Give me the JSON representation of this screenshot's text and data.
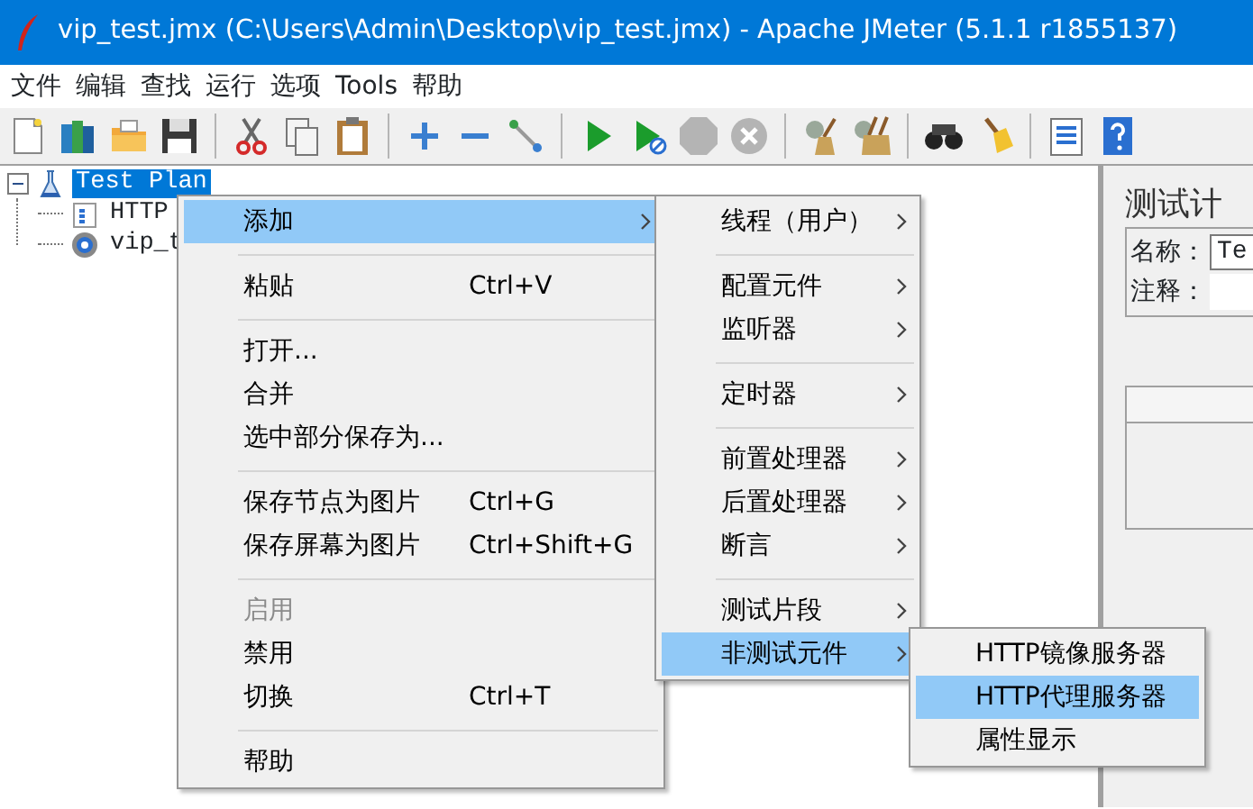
{
  "window": {
    "title": "vip_test.jmx (C:\\Users\\Admin\\Desktop\\vip_test.jmx) - Apache JMeter (5.1.1 r1855137)"
  },
  "menu_bar": [
    "文件",
    "编辑",
    "查找",
    "运行",
    "选项",
    "Tools",
    "帮助"
  ],
  "toolbar": [
    {
      "kind": "new",
      "disabled": false
    },
    {
      "kind": "templates",
      "disabled": false
    },
    {
      "kind": "open",
      "disabled": false
    },
    {
      "kind": "save",
      "disabled": false
    },
    {
      "kind": "separator"
    },
    {
      "kind": "cut",
      "disabled": false
    },
    {
      "kind": "copy",
      "disabled": false
    },
    {
      "kind": "paste",
      "disabled": false
    },
    {
      "kind": "separator"
    },
    {
      "kind": "expand",
      "disabled": false
    },
    {
      "kind": "collapse",
      "disabled": false
    },
    {
      "kind": "toggle",
      "disabled": false
    },
    {
      "kind": "separator"
    },
    {
      "kind": "start",
      "disabled": false
    },
    {
      "kind": "start-no-timers",
      "disabled": false
    },
    {
      "kind": "stop",
      "disabled": true
    },
    {
      "kind": "shutdown",
      "disabled": true
    },
    {
      "kind": "separator"
    },
    {
      "kind": "clear",
      "disabled": false
    },
    {
      "kind": "clear-all",
      "disabled": false
    },
    {
      "kind": "separator"
    },
    {
      "kind": "search",
      "disabled": false
    },
    {
      "kind": "reset-search",
      "disabled": false
    },
    {
      "kind": "separator"
    },
    {
      "kind": "function-helper",
      "disabled": false
    },
    {
      "kind": "help",
      "disabled": false
    }
  ],
  "tree": [
    {
      "label": "Test Plan",
      "kind": "test-plan",
      "selected": true,
      "expanded": true,
      "children": [
        {
          "label": "HTTP",
          "kind": "config",
          "selected": false
        },
        {
          "label": "vip_t",
          "kind": "thread-group",
          "selected": false
        }
      ]
    }
  ],
  "panel": {
    "title": "测试计",
    "fields": [
      {
        "label": "名称：",
        "value": "Te"
      },
      {
        "label": "注释："
      }
    ]
  },
  "context_menus": [
    {
      "items": [
        {
          "kind": "item",
          "label": "添加",
          "selected": true,
          "disabled": false,
          "submenu": true
        },
        {
          "kind": "separator"
        },
        {
          "kind": "item",
          "label": "粘贴",
          "shortcut": "Ctrl+V",
          "selected": false,
          "disabled": false,
          "submenu": false
        },
        {
          "kind": "separator"
        },
        {
          "kind": "item",
          "label": "打开...",
          "selected": false,
          "disabled": false,
          "submenu": false
        },
        {
          "kind": "item",
          "label": "合并",
          "selected": false,
          "disabled": false,
          "submenu": false
        },
        {
          "kind": "item",
          "label": "选中部分保存为...",
          "selected": false,
          "disabled": false,
          "submenu": false
        },
        {
          "kind": "separator"
        },
        {
          "kind": "item",
          "label": "保存节点为图片",
          "shortcut": "Ctrl+G",
          "selected": false,
          "disabled": false,
          "submenu": false
        },
        {
          "kind": "item",
          "label": "保存屏幕为图片",
          "shortcut": "Ctrl+Shift+G",
          "selected": false,
          "disabled": false,
          "submenu": false
        },
        {
          "kind": "separator"
        },
        {
          "kind": "item",
          "label": "启用",
          "selected": false,
          "disabled": true,
          "submenu": false
        },
        {
          "kind": "item",
          "label": "禁用",
          "selected": false,
          "disabled": false,
          "submenu": false
        },
        {
          "kind": "item",
          "label": "切换",
          "shortcut": "Ctrl+T",
          "selected": false,
          "disabled": false,
          "submenu": false
        },
        {
          "kind": "separator"
        },
        {
          "kind": "item",
          "label": "帮助",
          "selected": false,
          "disabled": false,
          "submenu": false
        }
      ]
    },
    {
      "items": [
        {
          "kind": "item",
          "label": "线程（用户）",
          "selected": false,
          "disabled": false,
          "submenu": true
        },
        {
          "kind": "separator"
        },
        {
          "kind": "item",
          "label": "配置元件",
          "selected": false,
          "disabled": false,
          "submenu": true
        },
        {
          "kind": "item",
          "label": "监听器",
          "selected": false,
          "disabled": false,
          "submenu": true
        },
        {
          "kind": "separator"
        },
        {
          "kind": "item",
          "label": "定时器",
          "selected": false,
          "disabled": false,
          "submenu": true
        },
        {
          "kind": "separator"
        },
        {
          "kind": "item",
          "label": "前置处理器",
          "selected": false,
          "disabled": false,
          "submenu": true
        },
        {
          "kind": "item",
          "label": "后置处理器",
          "selected": false,
          "disabled": false,
          "submenu": true
        },
        {
          "kind": "item",
          "label": "断言",
          "selected": false,
          "disabled": false,
          "submenu": true
        },
        {
          "kind": "separator"
        },
        {
          "kind": "item",
          "label": "测试片段",
          "selected": false,
          "disabled": false,
          "submenu": true
        },
        {
          "kind": "item",
          "label": "非测试元件",
          "selected": true,
          "disabled": false,
          "submenu": true
        }
      ]
    },
    {
      "items": [
        {
          "kind": "item",
          "label": "HTTP镜像服务器",
          "selected": false,
          "disabled": false,
          "submenu": false
        },
        {
          "kind": "item",
          "label": "HTTP代理服务器",
          "selected": true,
          "disabled": false,
          "submenu": false
        },
        {
          "kind": "item",
          "label": "属性显示",
          "selected": false,
          "disabled": false,
          "submenu": false
        }
      ]
    }
  ]
}
